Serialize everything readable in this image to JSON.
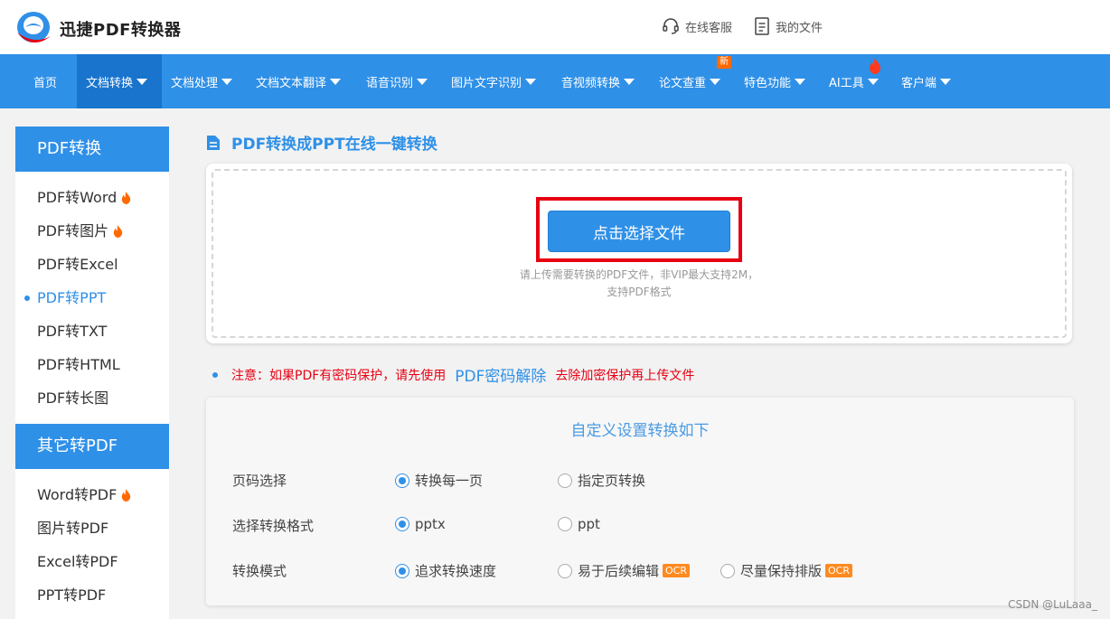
{
  "brand": {
    "name": "迅捷PDF转换器"
  },
  "header_links": {
    "service": "在线客服",
    "files": "我的文件"
  },
  "nav": {
    "items": [
      {
        "label": "首页",
        "dropdown": false
      },
      {
        "label": "文档转换",
        "dropdown": true
      },
      {
        "label": "文档处理",
        "dropdown": true
      },
      {
        "label": "文档文本翻译",
        "dropdown": true
      },
      {
        "label": "语音识别",
        "dropdown": true
      },
      {
        "label": "图片文字识别",
        "dropdown": true
      },
      {
        "label": "音视频转换",
        "dropdown": true
      },
      {
        "label": "论文查重",
        "dropdown": true
      },
      {
        "label": "特色功能",
        "dropdown": true
      },
      {
        "label": "AI工具",
        "dropdown": true
      },
      {
        "label": "客户端",
        "dropdown": true
      }
    ],
    "new_badge": "新"
  },
  "sidebar": {
    "section1": "PDF转换",
    "items1": [
      "PDF转Word",
      "PDF转图片",
      "PDF转Excel",
      "PDF转PPT",
      "PDF转TXT",
      "PDF转HTML",
      "PDF转长图"
    ],
    "section2": "其它转PDF",
    "items2": [
      "Word转PDF",
      "图片转PDF",
      "Excel转PDF",
      "PPT转PDF"
    ]
  },
  "main": {
    "title": "PDF转换成PPT在线一键转换",
    "upload_button": "点击选择文件",
    "hint_line1": "请上传需要转换的PDF文件，非VIP最大支持2M，",
    "hint_line2": "支持PDF格式"
  },
  "notice": {
    "prefix": "注意：如果PDF有密码保护，请先使用",
    "link": "PDF密码解除",
    "suffix": "去除加密保护再上传文件"
  },
  "settings": {
    "title": "自定义设置转换如下",
    "rows": [
      {
        "label": "页码选择",
        "options": [
          "转换每一页",
          "指定页转换"
        ]
      },
      {
        "label": "选择转换格式",
        "options": [
          "pptx",
          "ppt"
        ]
      },
      {
        "label": "转换模式",
        "options": [
          "追求转换速度",
          "易于后续编辑",
          "尽量保持排版"
        ]
      }
    ],
    "ocr_badge": "OCR"
  },
  "watermark": "CSDN @LuLaaa_",
  "colors": {
    "primary": "#2f90e7",
    "nav_active": "#1874cd",
    "alert_red": "#e60012",
    "fire_orange": "#ff6a00"
  }
}
